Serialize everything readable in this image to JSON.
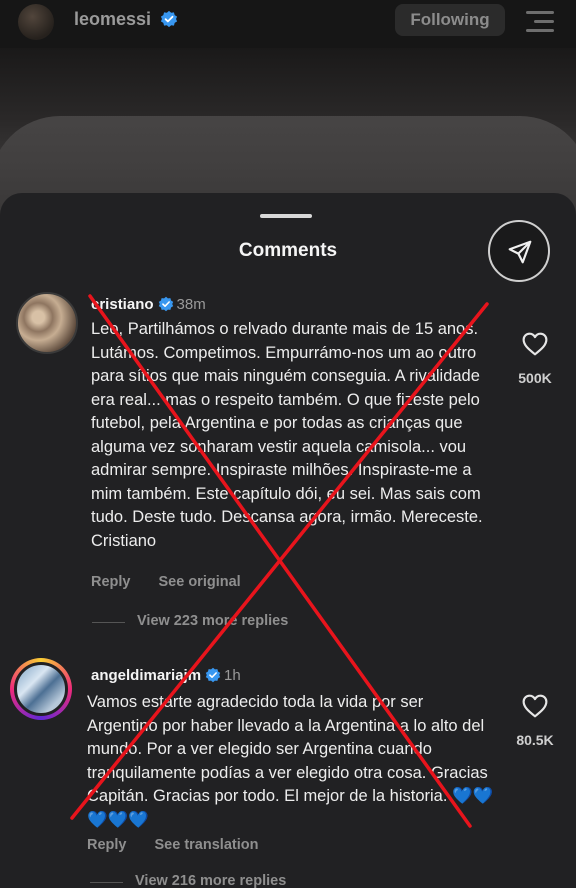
{
  "topbar": {
    "username": "leomessi",
    "follow_label": "Following"
  },
  "sheet": {
    "title": "Comments"
  },
  "comments": [
    {
      "username": "cristiano",
      "time": "38m",
      "text": "Leo, Partilhámos o relvado durante mais de 15 anos. Lutámos. Competimos. Empurrámo-nos um ao outro para sítios que mais ninguém conseguia. A rivalidade era real... mas o respeito também. O que fizeste pelo futebol, pela Argentina e por todas as crianças que alguma vez sonharam vestir aquela camisola... vou admirar sempre. Inspiraste milhões. Inspiraste-me a mim também. Este capítulo dói, eu sei. Mas sais com tudo. Deste tudo. Descansa agora, irmão. Mereceste. Cristiano",
      "reply_label": "Reply",
      "secondary_label": "See original",
      "view_replies": "View 223 more replies",
      "likes": "500K"
    },
    {
      "username": "angeldimariajm",
      "time": "1h",
      "text": "Vamos estarte agradecido toda la vida por ser Argentino por haber llevado a la Argentina a lo alto del mundo. Por a ver elegido ser Argentina cuando tranquilamente podías a ver elegido otra cosa. Gracias Capitán. Gracias por todo. El mejor de la historia. 💙💙💙💙💙",
      "reply_label": "Reply",
      "secondary_label": "See translation",
      "view_replies": "View 216 more replies",
      "likes": "80.5K"
    }
  ],
  "colors": {
    "verified_blue": "#3897f0",
    "overlay_red": "#e8141c"
  },
  "icons": [
    "verified-badge-icon",
    "menu-icon",
    "share-icon",
    "heart-icon"
  ]
}
